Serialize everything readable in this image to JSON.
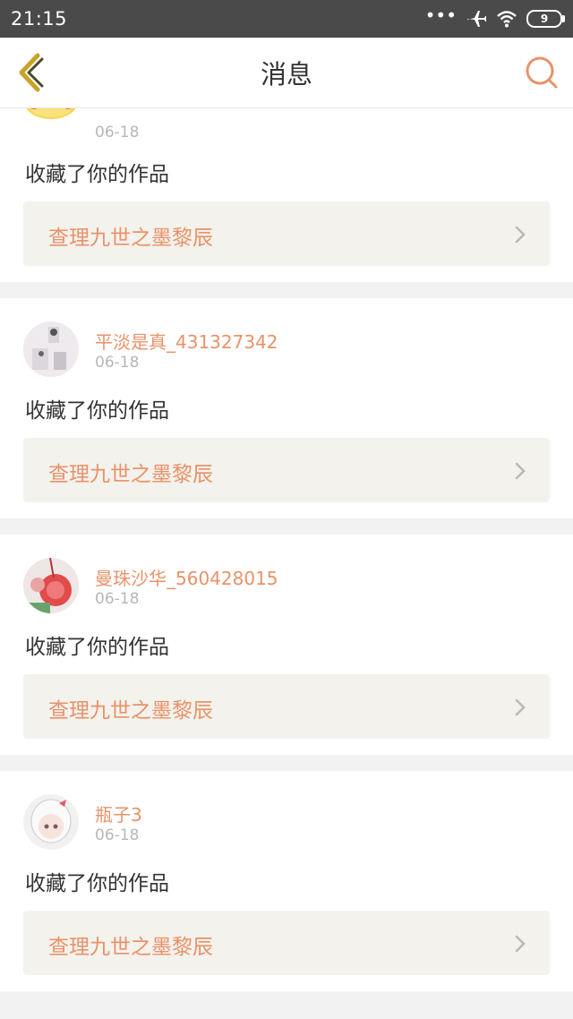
{
  "status_bar": {
    "time": "21:15",
    "battery": "9"
  },
  "header": {
    "title": "消息"
  },
  "colors": {
    "accent": "#e8926a",
    "back_icon": "#c9a227",
    "card_bg": "#f3f2ec"
  },
  "messages": [
    {
      "username": "",
      "date": "06-18",
      "action": "收藏了你的作品",
      "work_title": "查理九世之墨黎辰"
    },
    {
      "username": "平淡是真_431327342",
      "date": "06-18",
      "action": "收藏了你的作品",
      "work_title": "查理九世之墨黎辰"
    },
    {
      "username": "曼珠沙华_560428015",
      "date": "06-18",
      "action": "收藏了你的作品",
      "work_title": "查理九世之墨黎辰"
    },
    {
      "username": "瓶子3",
      "date": "06-18",
      "action": "收藏了你的作品",
      "work_title": "查理九世之墨黎辰"
    }
  ]
}
